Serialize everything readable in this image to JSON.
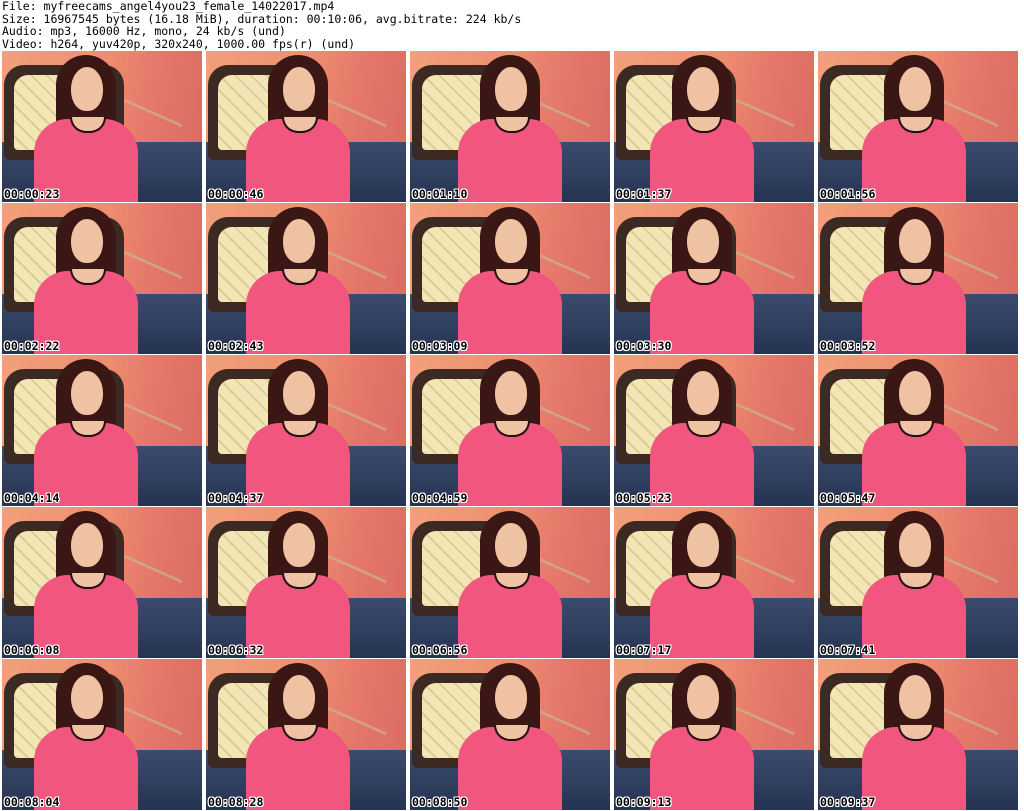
{
  "header": {
    "file_line": "File: myfreecams_angel4you23_female_14022017.mp4",
    "size_line": "Size: 16967545 bytes (16.18 MiB), duration: 00:10:06, avg.bitrate: 224 kb/s",
    "audio_line": "Audio: mp3, 16000 Hz, mono, 24 kb/s (und)",
    "video_line": "Video: h264, yuv420p, 320x240, 1000.00 fps(r) (und)"
  },
  "timestamps": [
    "00:00:23",
    "00:00:46",
    "00:01:10",
    "00:01:37",
    "00:01:56",
    "00:02:22",
    "00:02:43",
    "00:03:09",
    "00:03:30",
    "00:03:52",
    "00:04:14",
    "00:04:37",
    "00:04:59",
    "00:05:23",
    "00:05:47",
    "00:06:08",
    "00:06:32",
    "00:06:56",
    "00:07:17",
    "00:07:41",
    "00:08:04",
    "00:08:28",
    "00:08:50",
    "00:09:13",
    "00:09:37"
  ]
}
